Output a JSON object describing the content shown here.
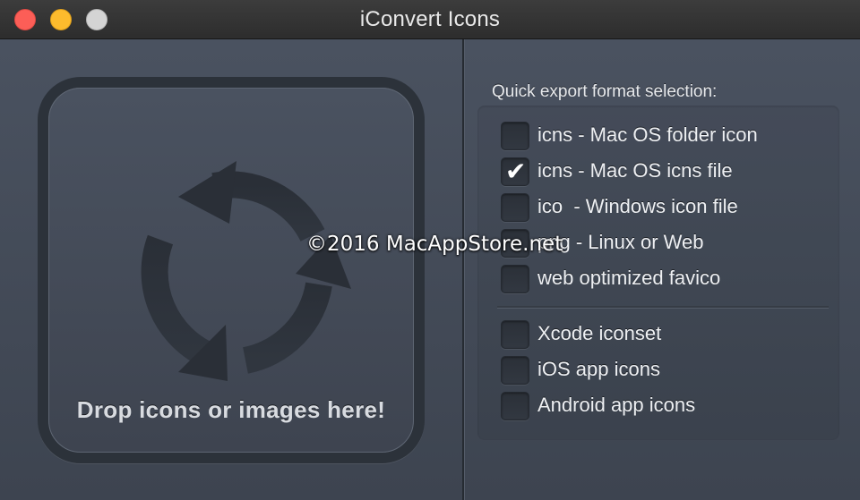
{
  "window": {
    "title": "iConvert Icons"
  },
  "drop_zone": {
    "label": "Drop icons or images here!",
    "icon": "refresh-arrows-icon"
  },
  "export": {
    "section_label": "Quick export format selection:",
    "options_group_1": [
      {
        "label": "icns - Mac OS folder icon",
        "checked": false
      },
      {
        "label": "icns - Mac OS icns file",
        "checked": true
      },
      {
        "label": "ico  - Windows icon file",
        "checked": false
      },
      {
        "label": "png - Linux or Web",
        "checked": false
      },
      {
        "label": "web optimized favico",
        "checked": false
      }
    ],
    "options_group_2": [
      {
        "label": "Xcode iconset",
        "checked": false
      },
      {
        "label": "iOS app icons",
        "checked": false
      },
      {
        "label": "Android app icons",
        "checked": false
      }
    ]
  },
  "watermark": "©2016 MacAppStore.net",
  "colors": {
    "close": "#fc5e57",
    "minimize": "#fdbb2d",
    "zoom": "#d4d4d4"
  }
}
